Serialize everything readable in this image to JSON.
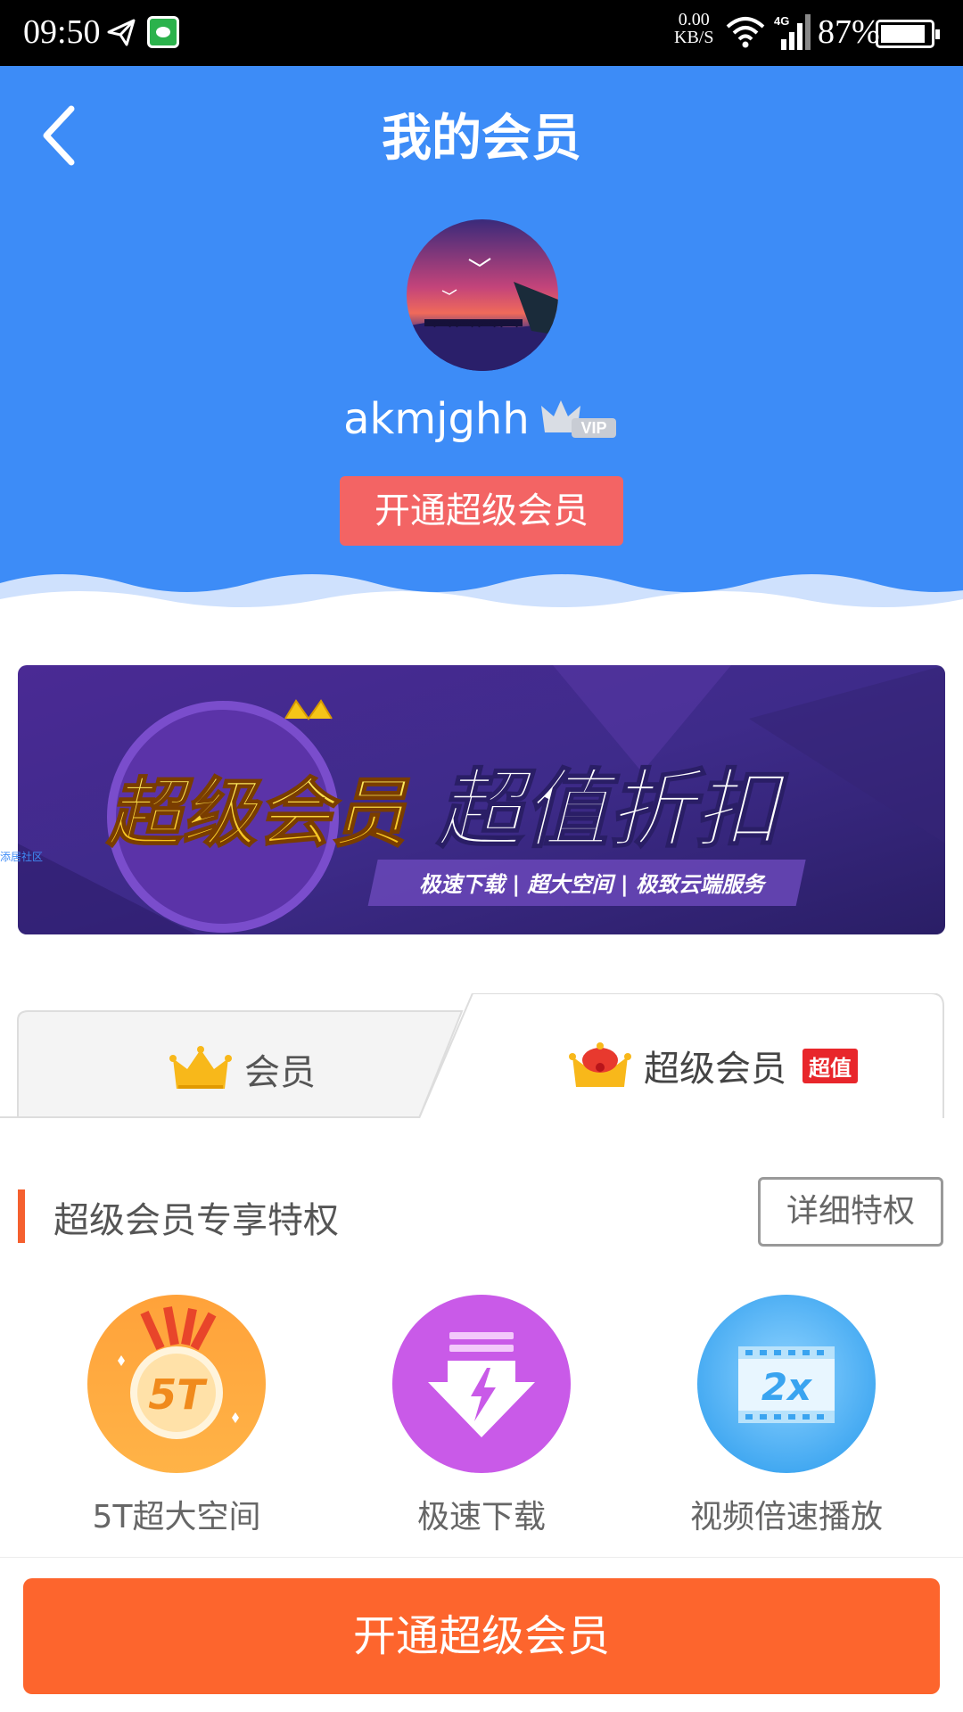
{
  "status_bar": {
    "time": "09:50",
    "speed_value": "0.00",
    "speed_unit": "KB/S",
    "network_type": "4G",
    "battery": "87%",
    "icons": [
      "send-icon",
      "wechat-icon",
      "wifi-icon",
      "signal-icon",
      "battery-icon"
    ]
  },
  "header": {
    "title": "我的会员",
    "back_icon": "chevron-left-icon",
    "username": "akmjghh",
    "vip_label": "VIP",
    "open_button": "开通超级会员"
  },
  "banner": {
    "logo_text": "超级会员",
    "headline": "超值折扣",
    "tagline": "极速下载 | 超大空间 | 极致云端服务"
  },
  "watermark": "添居社区",
  "tabs": [
    {
      "label": "会员",
      "icon": "crown-icon",
      "active": false
    },
    {
      "label": "超级会员",
      "icon": "crown-red-icon",
      "badge": "超值",
      "active": true
    }
  ],
  "section": {
    "title": "超级会员专享特权",
    "details_button": "详细特权"
  },
  "features": [
    {
      "label": "5T超大空间",
      "icon_text": "5T",
      "icon": "medal-icon"
    },
    {
      "label": "极速下载",
      "icon": "fast-download-icon"
    },
    {
      "label": "视频倍速播放",
      "icon_text": "2x",
      "icon": "video-speed-icon"
    }
  ],
  "bottom_button": "开通超级会员",
  "colors": {
    "header_bg": "#3d8cf7",
    "open_button_bg": "#f36464",
    "bottom_button_bg": "#fd652d",
    "accent_bar": "#f5602f",
    "hot_badge": "#e8262b"
  }
}
